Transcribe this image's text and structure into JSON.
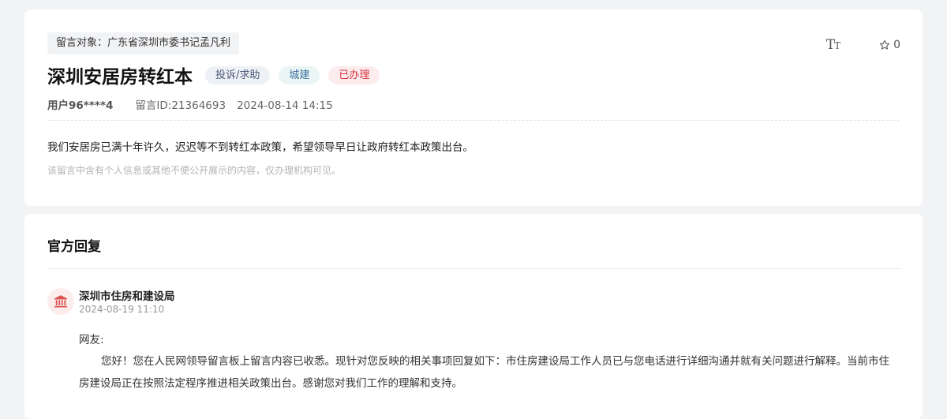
{
  "message": {
    "target": "留言对象：广东省深圳市委书记孟凡利",
    "tools": {
      "font_size_glyph_large": "T",
      "font_size_glyph_small": "T",
      "favorite_count": "0"
    },
    "title": "深圳安居房转红本",
    "tags": {
      "type": "投诉/求助",
      "field": "城建",
      "status": "已办理"
    },
    "user": "用户96****4",
    "message_id": "留言ID:21364693",
    "datetime": "2024-08-14 14:15",
    "content": "我们安居房已满十年许久，迟迟等不到转红本政策，希望领导早日让政府转红本政策出台。",
    "privacy_note": "该留言中含有个人信息或其他不便公开展示的内容，仅办理机构可见。"
  },
  "reply": {
    "heading": "官方回复",
    "org": "深圳市住房和建设局",
    "date": "2024-08-19 11:10",
    "greeting": "网友:",
    "body": "您好！您在人民网领导留言板上留言内容已收悉。现针对您反映的相关事项回复如下：市住房建设局工作人员已与您电话进行详细沟通并就有关问题进行解释。当前市住房建设局正在按照法定程序推进相关政策出台。感谢您对我们工作的理解和支持。"
  },
  "colors": {
    "status_red": "#d9363e",
    "org_icon": "#d9534f",
    "page_bg": "#f2f3f5"
  }
}
